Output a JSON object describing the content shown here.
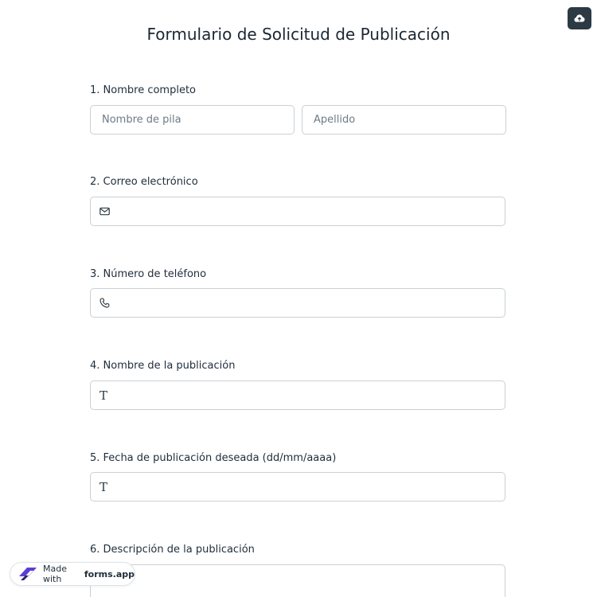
{
  "header": {
    "title": "Formulario de Solicitud de Publicación",
    "save_icon": "cloud-upload-icon"
  },
  "questions": [
    {
      "label": "1. Nombre completo",
      "fields": [
        {
          "placeholder": "Nombre de pila"
        },
        {
          "placeholder": "Apellido"
        }
      ]
    },
    {
      "label": "2. Correo electrónico",
      "icon": "envelope-icon"
    },
    {
      "label": "3. Número de teléfono",
      "icon": "phone-icon"
    },
    {
      "label": "4. Nombre de la publicación",
      "icon": "text-t-icon",
      "icon_glyph": "T"
    },
    {
      "label": "5. Fecha de publicación deseada (dd/mm/aaaa)",
      "icon": "text-t-icon",
      "icon_glyph": "T"
    },
    {
      "label": "6. Descripción de la publicación"
    }
  ],
  "footer_badge": {
    "made_with": "Made with",
    "brand": "forms.app"
  },
  "colors": {
    "accent_dark": "#2c3a44",
    "border": "#c9d0d6",
    "logo_purple": "#5b3fd1"
  }
}
